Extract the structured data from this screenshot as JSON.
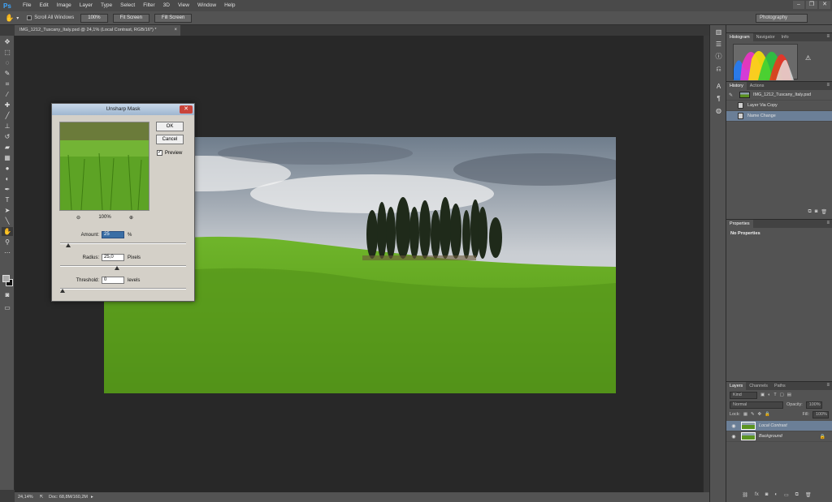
{
  "app": {
    "logo": "Ps",
    "menu": [
      "File",
      "Edit",
      "Image",
      "Layer",
      "Type",
      "Select",
      "Filter",
      "3D",
      "View",
      "Window",
      "Help"
    ],
    "window_controls": [
      "–",
      "❐",
      "✕"
    ]
  },
  "options_bar": {
    "tool_icon": "hand-icon",
    "scroll_all_label": "Scroll All Windows",
    "scroll_all_checked": false,
    "buttons": [
      "100%",
      "Fit Screen",
      "Fill Screen"
    ],
    "workspace": "Photography"
  },
  "document": {
    "tab_title": "IMG_1212_Tuscany_Italy.psd @ 24,1% (Local Contrast, RGB/16*) *",
    "tab_close": "×"
  },
  "status_bar": {
    "zoom": "24,14%",
    "doc_info": "Doc: 68,8M/160,2M"
  },
  "panels": {
    "histogram": {
      "tabs": [
        "Histogram",
        "Navigator",
        "Info"
      ],
      "active": 0
    },
    "history": {
      "tabs": [
        "History",
        "Actions"
      ],
      "active": 0,
      "items": [
        {
          "label": "IMG_1212_Tuscany_Italy.psd",
          "type": "snapshot"
        },
        {
          "label": "Layer Via Copy",
          "type": "step"
        },
        {
          "label": "Name Change",
          "type": "step",
          "selected": true
        }
      ]
    },
    "properties": {
      "tabs": [
        "Properties"
      ],
      "active": 0,
      "message": "No Properties"
    },
    "layers": {
      "tabs": [
        "Layers",
        "Channels",
        "Paths"
      ],
      "active": 0,
      "filter_kind": "Kind",
      "blend_mode": "Normal",
      "opacity_label": "Opacity:",
      "opacity_value": "100%",
      "lock_label": "Lock:",
      "fill_label": "Fill:",
      "fill_value": "100%",
      "items": [
        {
          "name": "Local Contrast",
          "selected": true,
          "locked": false
        },
        {
          "name": "Background",
          "selected": false,
          "locked": true
        }
      ]
    }
  },
  "dialog": {
    "title": "Unsharp Mask",
    "ok_label": "OK",
    "cancel_label": "Cancel",
    "preview_label": "Preview",
    "preview_checked": true,
    "zoom_level": "100%",
    "amount": {
      "label": "Amount:",
      "value": "25",
      "unit": "%",
      "slider_fraction": 0.05
    },
    "radius": {
      "label": "Radius:",
      "value": "25,0",
      "unit": "Pixels",
      "slider_fraction": 0.45
    },
    "threshold": {
      "label": "Threshold:",
      "value": "0",
      "unit": "levels",
      "slider_fraction": 0.0
    }
  },
  "colors": {
    "selection": "#6b7f97",
    "dialog_bg": "#d4d0c8",
    "accent": "#3fa7ff"
  }
}
